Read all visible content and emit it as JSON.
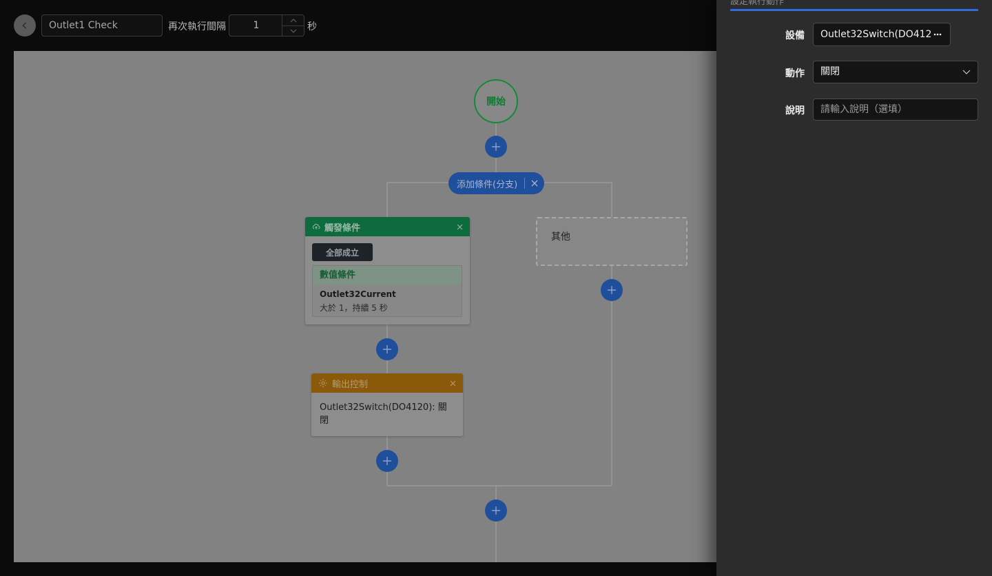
{
  "toolbar": {
    "name_value": "Outlet1 Check",
    "interval_label": "再次執行間隔",
    "interval_value": "1",
    "interval_unit": "秒"
  },
  "flow": {
    "start_label": "開始",
    "branch_label": "添加條件(分支)",
    "trigger": {
      "title": "觸發條件",
      "all_label": "全部成立",
      "condition_type": "數值條件",
      "condition_name": "Outlet32Current",
      "condition_desc": "大於 1，持續 5 秒"
    },
    "else_label": "其他",
    "output": {
      "title": "輸出控制",
      "text": "Outlet32Switch(DO4120): 關閉"
    }
  },
  "panel": {
    "title": "設定執行動作",
    "device_label": "設備",
    "device_value": "Outlet32Switch(DO412",
    "action_label": "動作",
    "action_value": "關閉",
    "desc_label": "說明",
    "desc_placeholder": "請輸入說明（選填）"
  },
  "colors": {
    "accent": "#2f6bdc",
    "start_green": "#138a3a",
    "trigger_header": "#0e6b3e",
    "output_header": "#8a5a0a",
    "plus_blue": "#1f4f9a"
  }
}
